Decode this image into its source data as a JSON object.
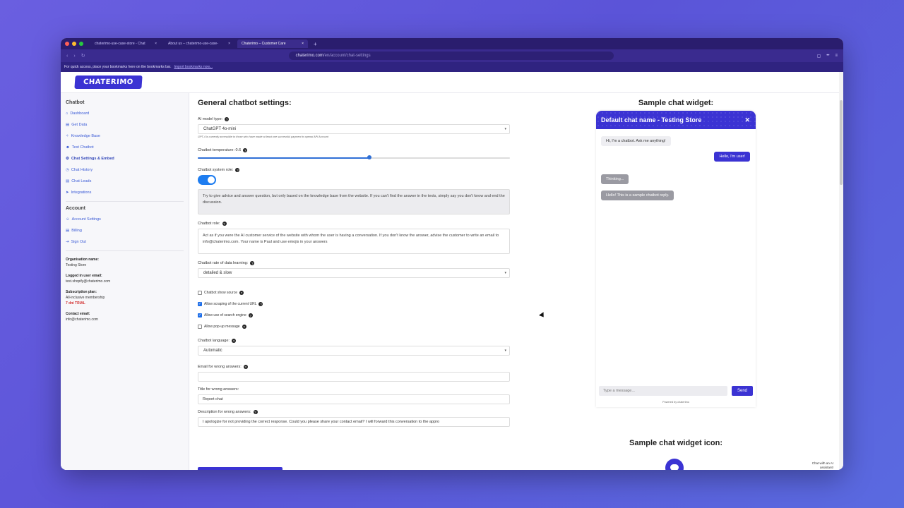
{
  "browser": {
    "tabs": [
      {
        "label": "chaterimo-use-case-store - Chat",
        "active": false
      },
      {
        "label": "About us – chaterimo-use-case-",
        "active": false
      },
      {
        "label": "Chaterimo – Customer Care",
        "active": true
      }
    ],
    "url_host": "chaterimo.com",
    "url_path": "/en/account/chat-settings",
    "bookmarks_text": "For quick access, place your bookmarks here on the bookmarks bar.",
    "bookmarks_link": "Import bookmarks now..."
  },
  "brand": {
    "logo": "CHATERIMO",
    "accent": "#3b33d3"
  },
  "sidebar": {
    "section_chatbot": "Chatbot",
    "items": [
      {
        "label": "Dashboard",
        "icon": "home-icon",
        "active": false
      },
      {
        "label": "Get Data",
        "icon": "document-icon",
        "active": false
      },
      {
        "label": "Knowledge Base",
        "icon": "lightbulb-icon",
        "active": false
      },
      {
        "label": "Test Chatbot",
        "icon": "robot-icon",
        "active": false
      },
      {
        "label": "Chat Settings & Embed",
        "icon": "gears-icon",
        "active": true
      },
      {
        "label": "Chat History",
        "icon": "history-icon",
        "active": false
      },
      {
        "label": "Chat Leads",
        "icon": "document-icon",
        "active": false
      },
      {
        "label": "Integrations",
        "icon": "send-icon",
        "active": false
      }
    ],
    "section_account": "Account",
    "account_items": [
      {
        "label": "Account Settings",
        "icon": "users-icon"
      },
      {
        "label": "Billing",
        "icon": "document-icon"
      },
      {
        "label": "Sign Out",
        "icon": "logout-icon"
      }
    ],
    "org_label": "Organisation name:",
    "org_value": "Testing Store",
    "email_label": "Logged in user email:",
    "email_value": "test.shopify@chaterimo.com",
    "plan_label": "Subscription plan:",
    "plan_value": "All-inclusive membership",
    "plan_trial": "7 dni TRIAL",
    "contact_label": "Contact email:",
    "contact_value": "info@chaterimo.com"
  },
  "settings": {
    "title": "General chatbot settings:",
    "model_label": "AI model type:",
    "model_value": "ChatGPT 4o-mini",
    "model_hint": "GPT-4 is currently accessible to those who have made at least one successful payment to openai API Account",
    "temp_label": "Chatbot temperature: 0.6",
    "temp_value": 0.55,
    "system_role_label": "Chatbot system role:",
    "system_role_text": "Try to give advice and answer question, but only based on the knowledge base from the website. If you can't find the answer in the texts, simply say you don't know and end the discussion.",
    "role_label": "Chatbot role:",
    "role_text": "Act as if you were the AI customer service of the website with whom the user is having a conversation. If you don't know the answer, advise the customer to write an email to info@chaterimo.com. Your name is Paul and use emojis in your answers",
    "learning_label": "Chatbot rate of data learning:",
    "learning_value": "detailed & slow",
    "checks": [
      {
        "label": "Chatbot show source",
        "checked": false
      },
      {
        "label": "Allow scraping of the current URL",
        "checked": true
      },
      {
        "label": "Allow use of search engine",
        "checked": true
      },
      {
        "label": "Allow pop-up message",
        "checked": false
      }
    ],
    "language_label": "Chatbot language:",
    "language_value": "Automatic",
    "wrong_email_label": "Email for wrong answers:",
    "wrong_email_value": "",
    "wrong_title_label": "Title for wrong answers:",
    "wrong_title_value": "Report chat",
    "wrong_desc_label": "Description for wrong answers:",
    "wrong_desc_value": "I apologize for not providing the correct response. Could you please share your contact email? I will forward this conversation to the appro"
  },
  "widget": {
    "title": "Sample chat widget:",
    "chat_name": "Default chat name - Testing Store",
    "messages": {
      "bot_greeting": "Hi, I'm a chatbot. Ask me anything!",
      "user": "Hello, I'm user!",
      "thinking": "Thinking...",
      "bot_reply": "Hello! This is a sample chatbot reply."
    },
    "input_placeholder": "Type a message...",
    "send_label": "Send",
    "powered": "Powered by chaterimo",
    "icon_title": "Sample chat widget icon:",
    "float_label": "Chat with an AI assistant!"
  }
}
